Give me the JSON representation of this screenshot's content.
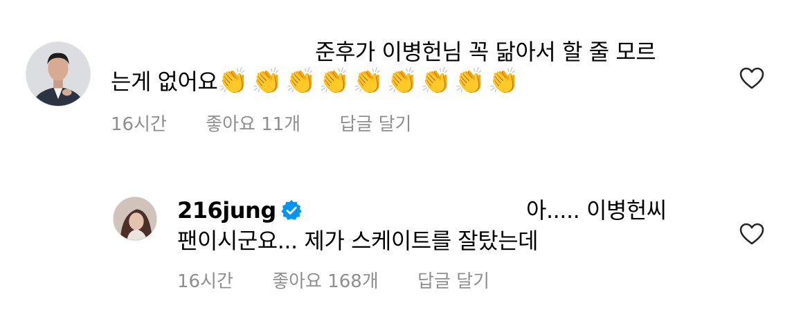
{
  "comments": [
    {
      "avatar_icon": "profile-photo-man-in-suit",
      "text_line1": "준후가 이병헌님 꼭 닮아서 할 줄 모르",
      "text_line2": "는게 없어요",
      "emoji": "👏👏👏👏👏👏👏👏👏",
      "time": "16시간",
      "likes": "좋아요 11개",
      "reply": "답글 달기",
      "like_icon": "heart-outline-icon"
    },
    {
      "avatar_icon": "profile-photo-woman",
      "username": "216jung",
      "verified_icon": "verified-badge-icon",
      "verified_color": "#0095f6",
      "text_line1": "아..... 이병헌씨",
      "text_line2": "팬이시군요... 제가 스케이트를 잘탔는데",
      "time": "16시간",
      "likes": "좋아요 168개",
      "reply": "답글 달기",
      "like_icon": "heart-outline-icon"
    }
  ]
}
